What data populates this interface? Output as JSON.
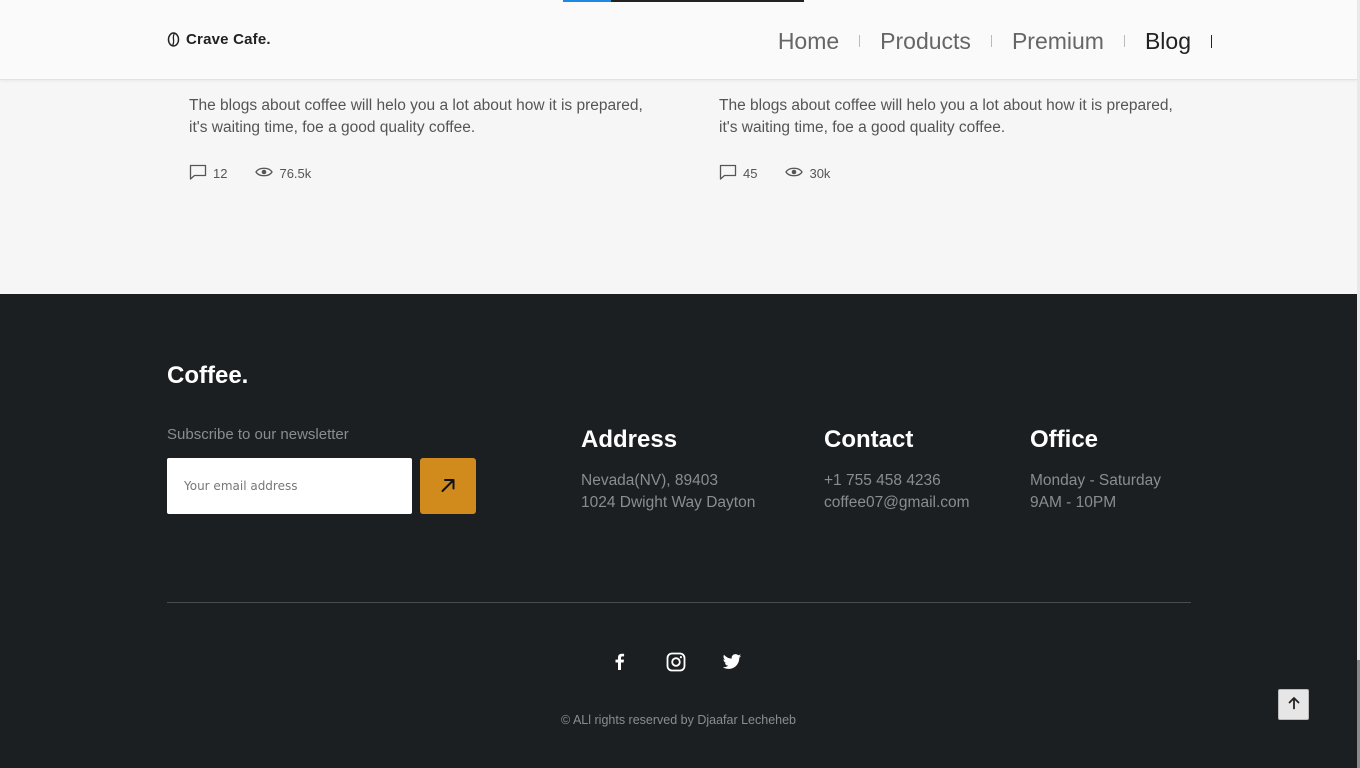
{
  "header": {
    "logo_text": "Crave Cafe.",
    "nav": [
      {
        "label": "Home",
        "active": false
      },
      {
        "label": "Products",
        "active": false
      },
      {
        "label": "Premium",
        "active": false
      },
      {
        "label": "Blog",
        "active": true
      }
    ]
  },
  "blog": {
    "cards": [
      {
        "excerpt": "The blogs about coffee will helo you a lot about how it is prepared, it's waiting time, foe a good quality coffee.",
        "comments": "12",
        "views": "76.5k"
      },
      {
        "excerpt": "The blogs about coffee will helo you a lot about how it is prepared, it's waiting time, foe a good quality coffee.",
        "comments": "45",
        "views": "30k"
      }
    ]
  },
  "footer": {
    "brand": "Coffee.",
    "newsletter_label": "Subscribe to our newsletter",
    "email_placeholder": "Your email address",
    "address": {
      "title": "Address",
      "line1": "Nevada(NV), 89403",
      "line2": "1024 Dwight Way Dayton"
    },
    "contact": {
      "title": "Contact",
      "line1": "+1 755 458 4236",
      "line2": "coffee07@gmail.com"
    },
    "office": {
      "title": "Office",
      "line1": "Monday - Saturday",
      "line2": "9AM - 10PM"
    },
    "socials": [
      "facebook-icon",
      "instagram-icon",
      "twitter-icon"
    ],
    "copyright": "© ALl rights reserved by Djaafar Lecheheb"
  },
  "colors": {
    "accent": "#d08b1c",
    "footer_bg": "#1c1f22",
    "page_bg": "#f6f6f6"
  }
}
